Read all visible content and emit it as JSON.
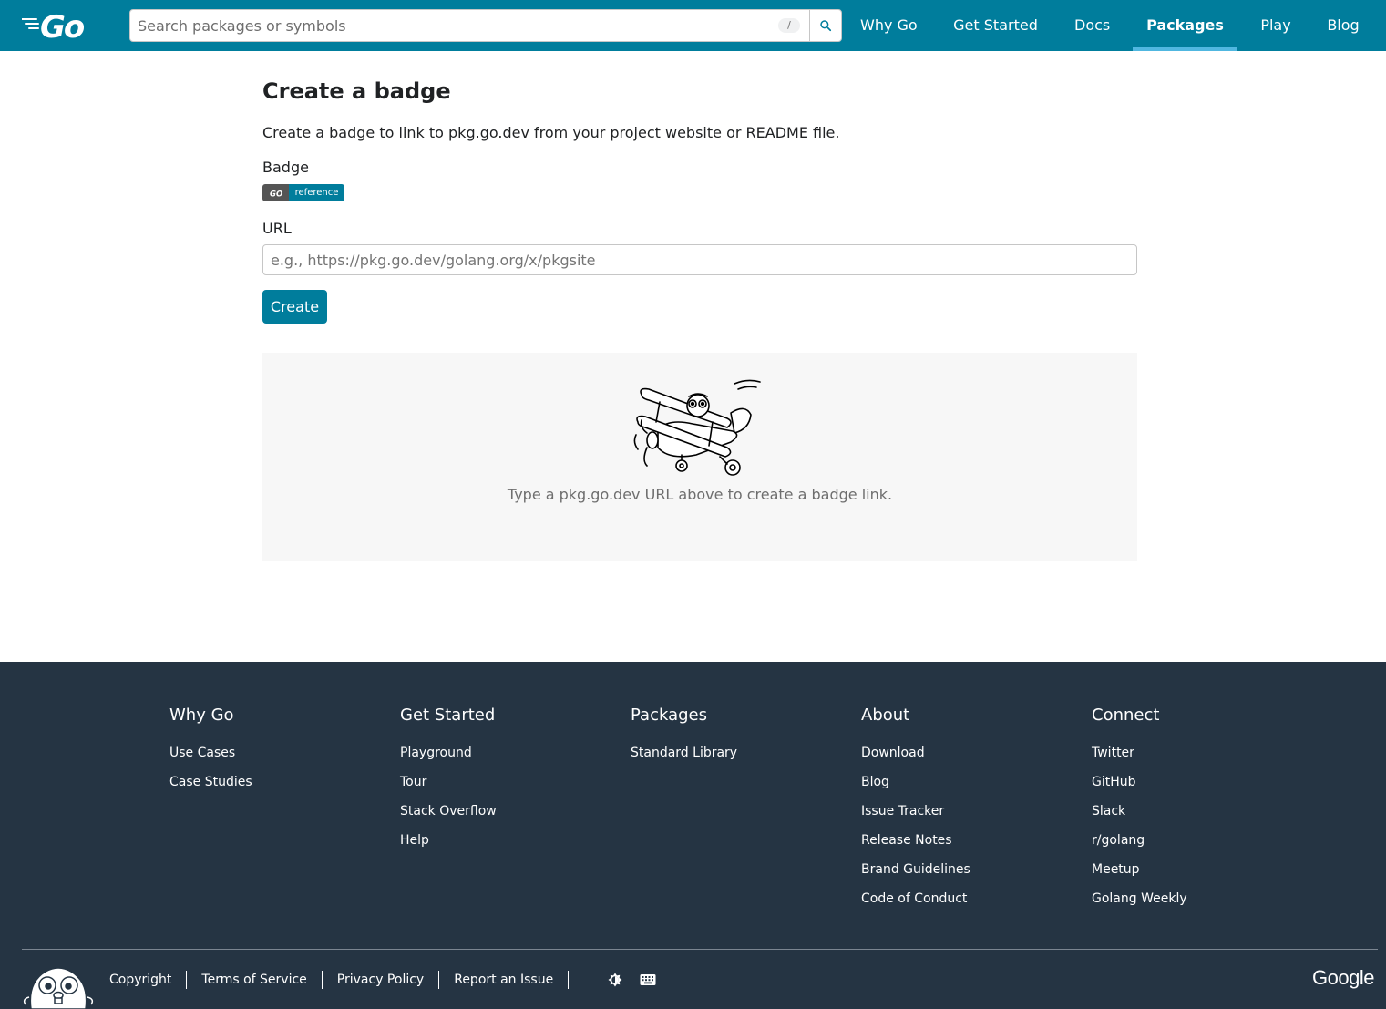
{
  "header": {
    "logo_alt": "Go",
    "search": {
      "placeholder": "Search packages or symbols",
      "shortcut_hint": "/",
      "button_icon": "search-icon"
    },
    "nav": [
      {
        "label": "Why Go",
        "active": false
      },
      {
        "label": "Get Started",
        "active": false
      },
      {
        "label": "Docs",
        "active": false
      },
      {
        "label": "Packages",
        "active": true
      },
      {
        "label": "Play",
        "active": false
      },
      {
        "label": "Blog",
        "active": false
      }
    ]
  },
  "main": {
    "title": "Create a badge",
    "intro": "Create a badge to link to pkg.go.dev from your project website or README file.",
    "badge_label": "Badge",
    "badge": {
      "left": "GO",
      "right": "reference"
    },
    "url_label": "URL",
    "url_placeholder": "e.g., https://pkg.go.dev/golang.org/x/pkgsite",
    "url_value": "",
    "create_button": "Create",
    "result_message": "Type a pkg.go.dev URL above to create a badge link."
  },
  "footer": {
    "columns": [
      {
        "heading": "Why Go",
        "links": [
          "Use Cases",
          "Case Studies"
        ]
      },
      {
        "heading": "Get Started",
        "links": [
          "Playground",
          "Tour",
          "Stack Overflow",
          "Help"
        ]
      },
      {
        "heading": "Packages",
        "links": [
          "Standard Library"
        ]
      },
      {
        "heading": "About",
        "links": [
          "Download",
          "Blog",
          "Issue Tracker",
          "Release Notes",
          "Brand Guidelines",
          "Code of Conduct"
        ]
      },
      {
        "heading": "Connect",
        "links": [
          "Twitter",
          "GitHub",
          "Slack",
          "r/golang",
          "Meetup",
          "Golang Weekly"
        ]
      }
    ],
    "bottom_links": [
      "Copyright",
      "Terms of Service",
      "Privacy Policy",
      "Report an Issue"
    ],
    "theme_icon": "theme-toggle-icon",
    "keyboard_icon": "keyboard-icon",
    "google_logo": "Google"
  },
  "colors": {
    "brand": "#007d9c",
    "footer_bg": "#253443",
    "result_bg": "#f7f7f7"
  }
}
